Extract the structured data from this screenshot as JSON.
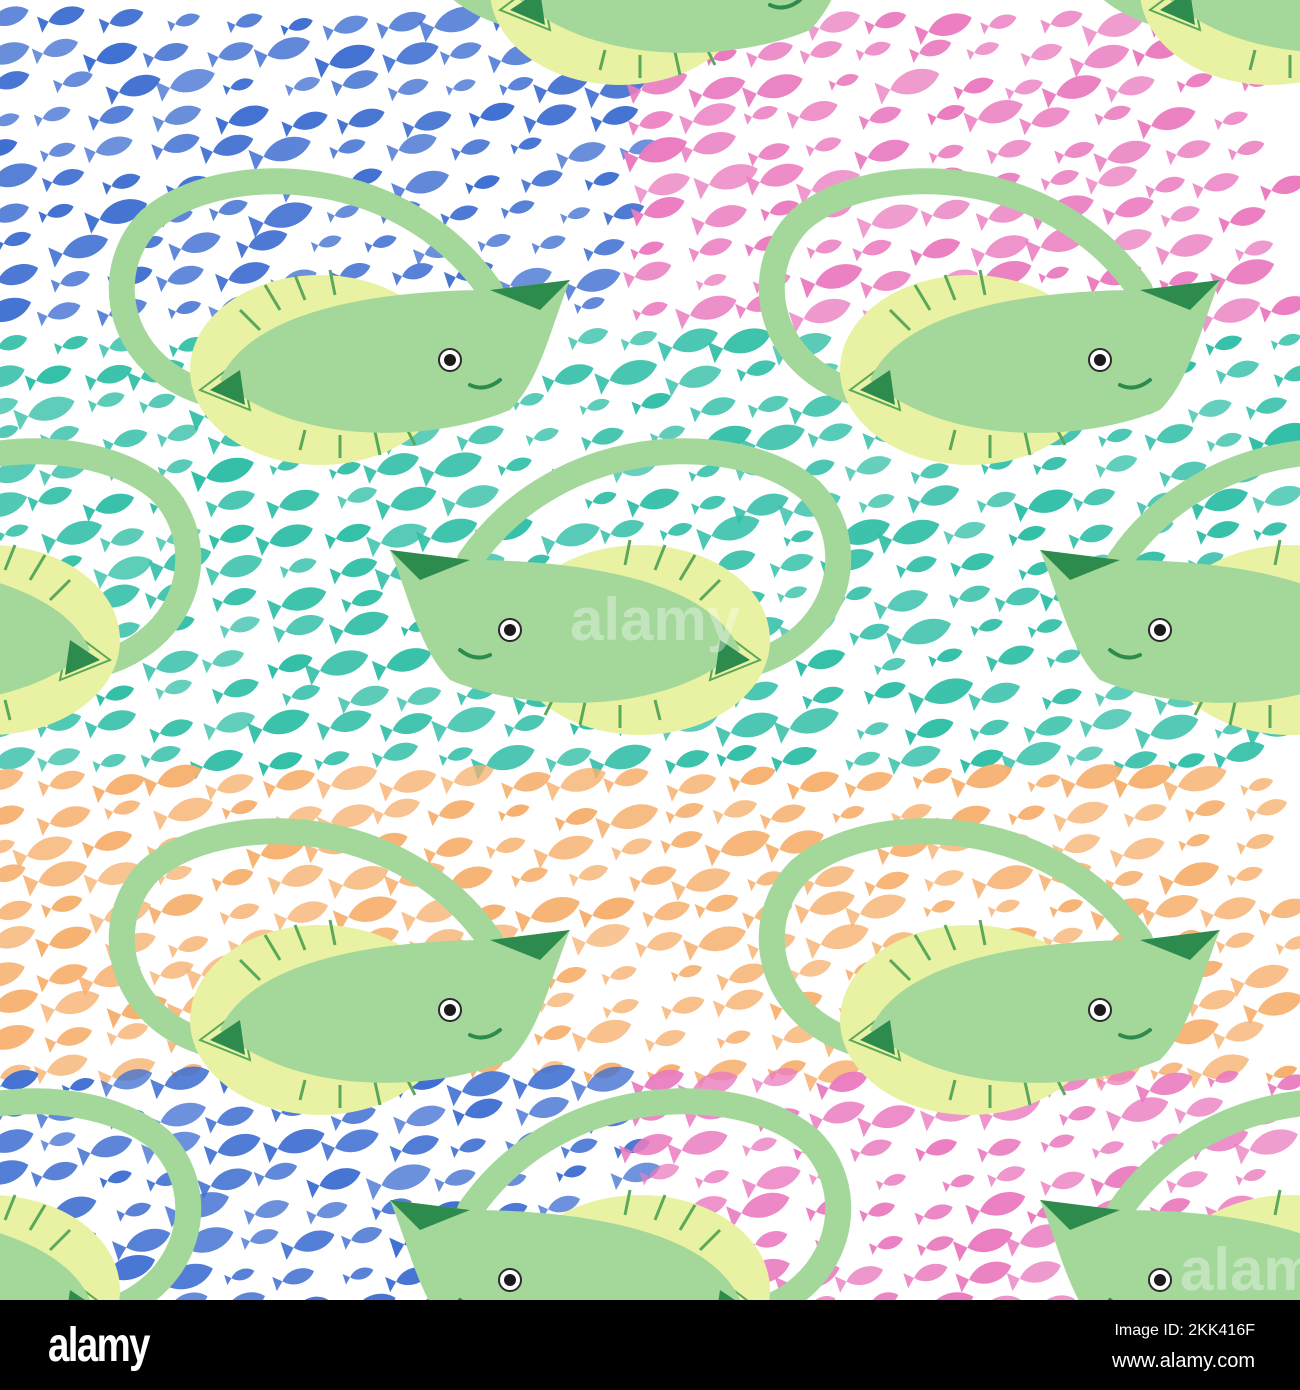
{
  "footer": {
    "logo": "alamy",
    "image_id": "Image ID: 2KK416F",
    "website": "www.alamy.com"
  },
  "watermark": "alamy",
  "colors": {
    "ray_body": "#a4d89b",
    "ray_dark": "#2e8b4e",
    "ray_fringe": "#e9f2a2",
    "blue_fish": "#3f6fd1",
    "pink_fish": "#ea7bbf",
    "teal_fish": "#33bfa8",
    "orange_fish": "#f6b170"
  }
}
